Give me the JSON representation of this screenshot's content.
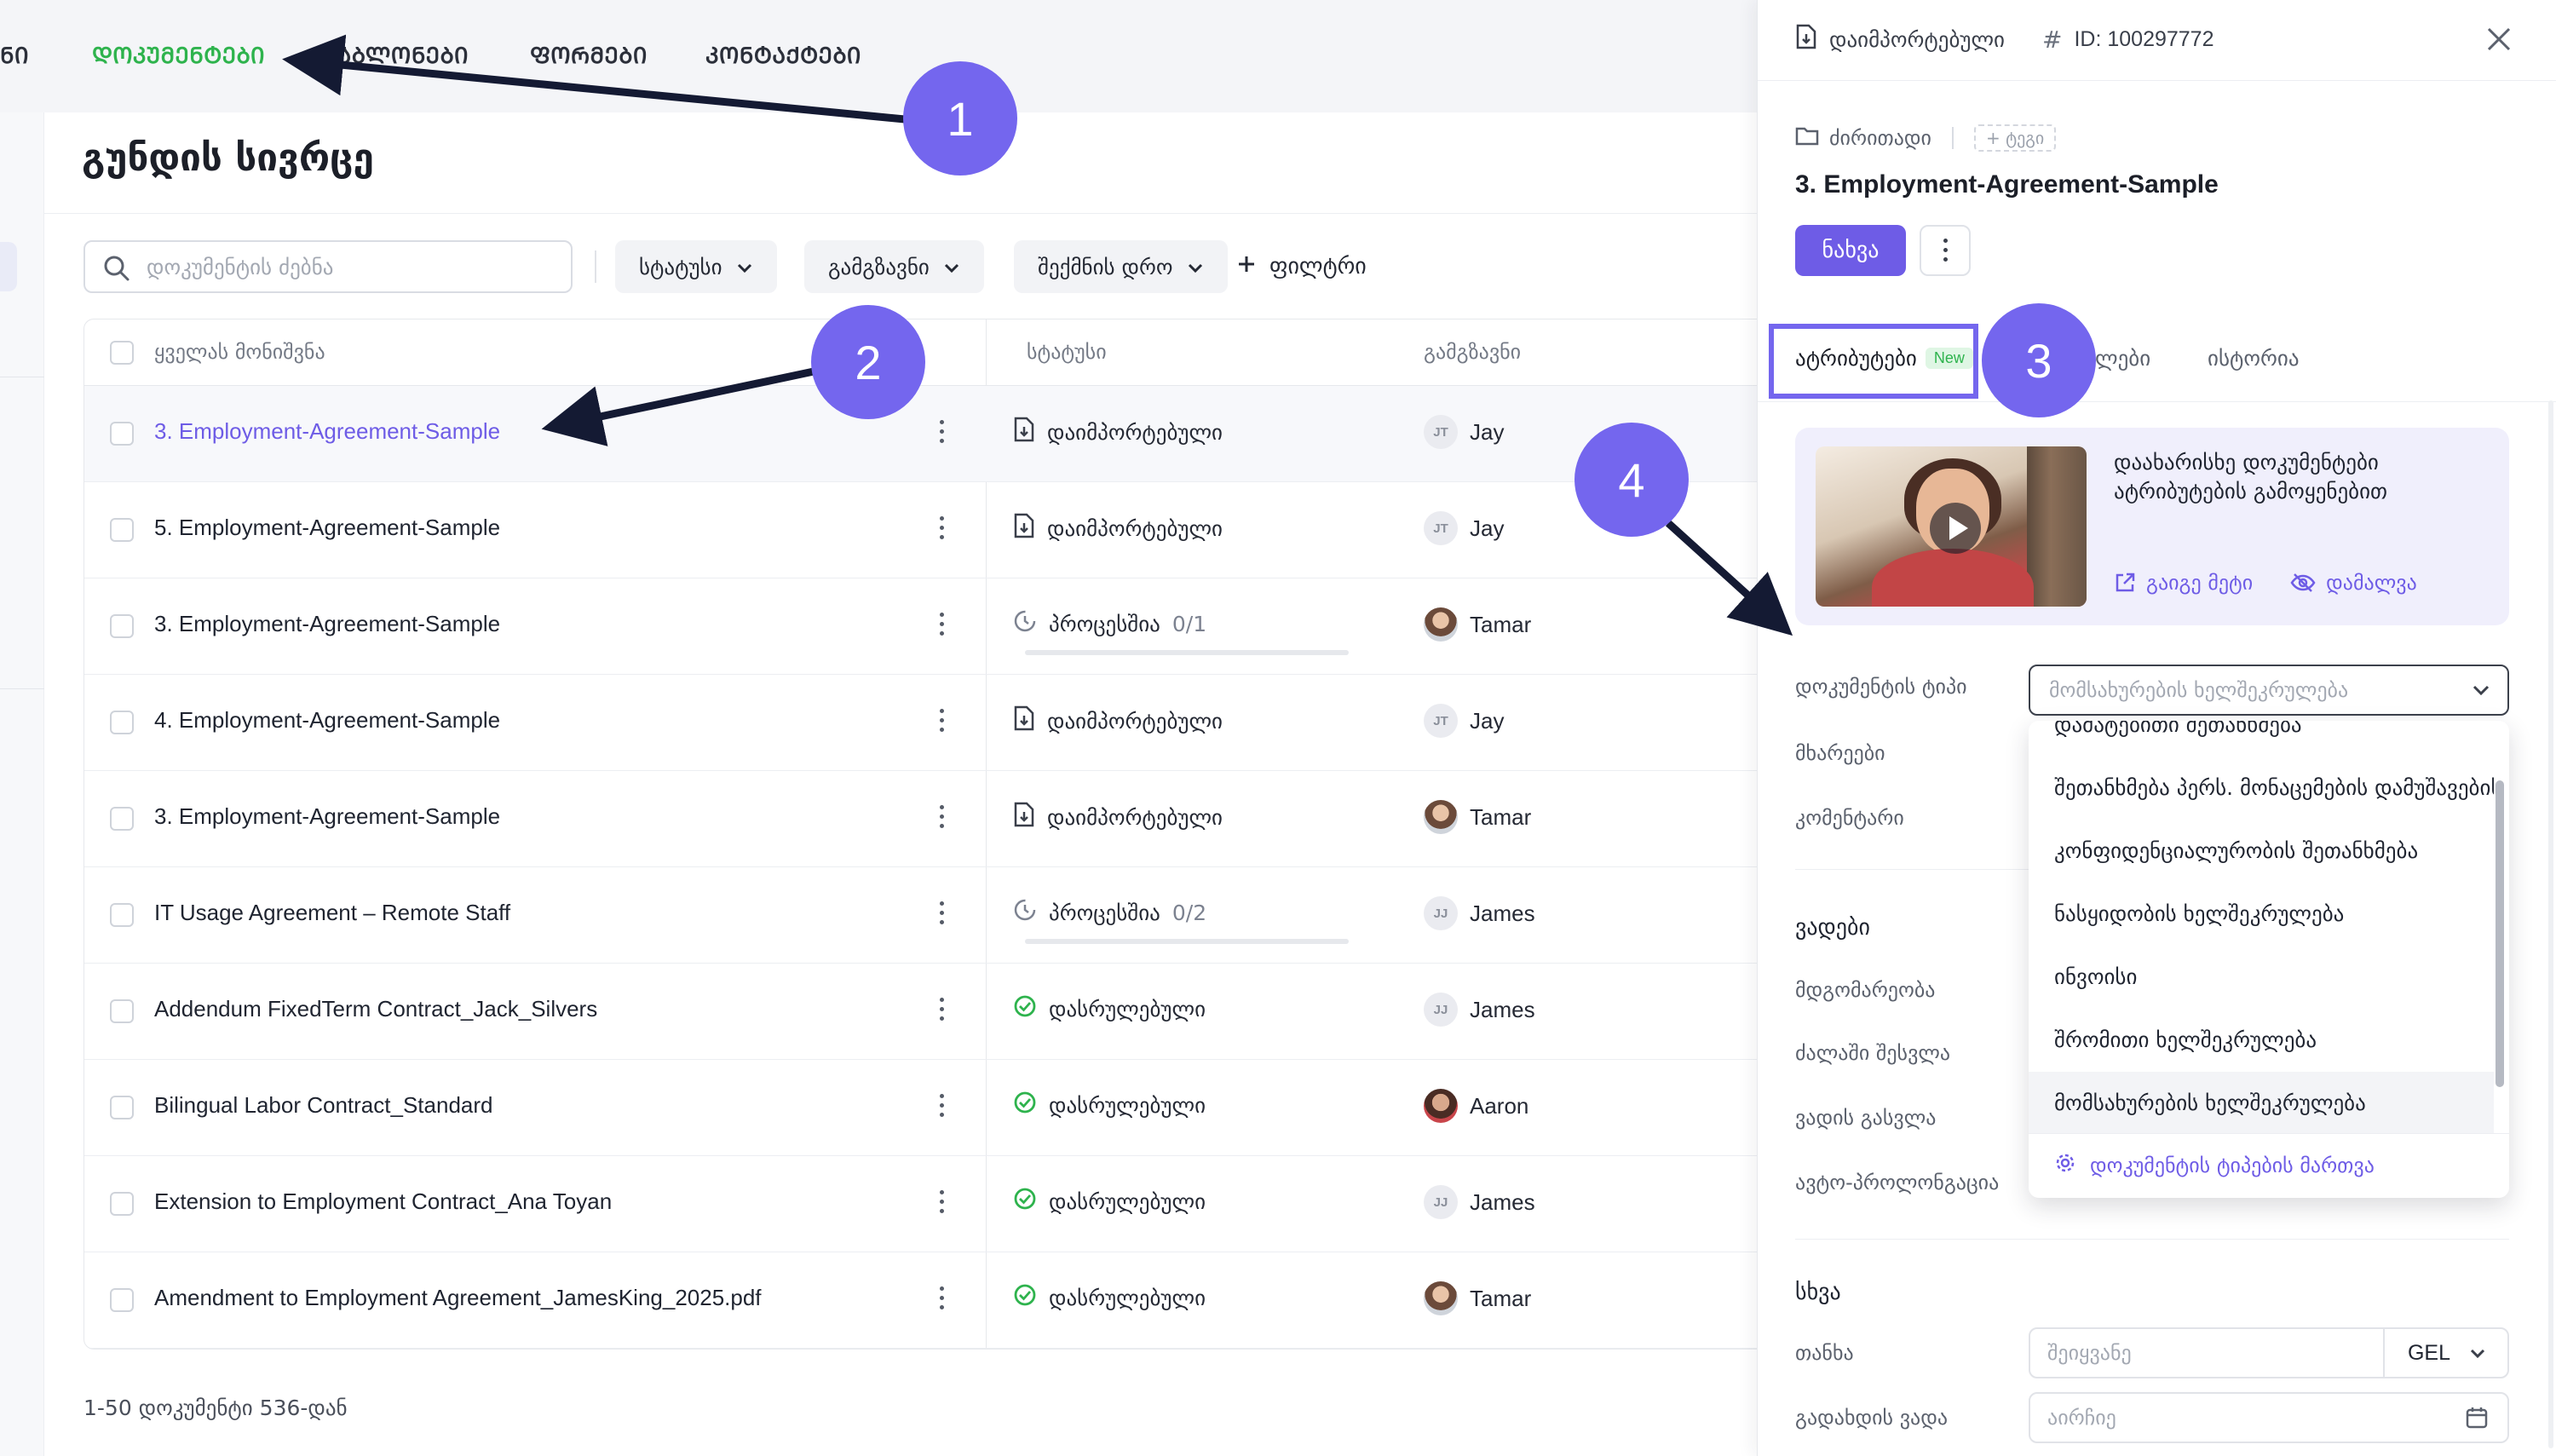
{
  "topnav": {
    "tabs": [
      {
        "label": "ᲜᲘ"
      },
      {
        "label": "ᲓᲝᲙᲣᲛᲔᲜᲢᲔᲑᲘ",
        "active": true
      },
      {
        "label": "ᲨᲐᲑᲚᲝᲜᲔᲑᲘ"
      },
      {
        "label": "ᲤᲝᲠᲛᲔᲑᲘ"
      },
      {
        "label": "ᲙᲝᲜᲢᲐᲥᲢᲔᲑᲘ"
      }
    ]
  },
  "page": {
    "title": "გუნდის სივრცე",
    "search_placeholder": "დოკუმენტის ძებნა",
    "filters": {
      "status": "სტატუსი",
      "sender": "გამგზავნი",
      "created": "შექმნის დრო",
      "add_filter": "ფილტრი"
    },
    "table": {
      "headers": {
        "select_all": "ყველას მონიშვნა",
        "status": "სტატუსი",
        "sender": "გამგზავნი"
      },
      "rows": [
        {
          "name": "3. Employment-Agreement-Sample",
          "status": "დაიმპორტებული",
          "status_type": "imported",
          "sender": "Jay",
          "initials": "JT",
          "avatar": "initials",
          "highlight": true
        },
        {
          "name": "5. Employment-Agreement-Sample",
          "status": "დაიმპორტებული",
          "status_type": "imported",
          "sender": "Jay",
          "initials": "JT",
          "avatar": "initials"
        },
        {
          "name": "3. Employment-Agreement-Sample",
          "status": "პროცესშია",
          "status_count": "0/1",
          "status_type": "progress",
          "progress": 0,
          "sender": "Tamar",
          "initials": "",
          "avatar": "photo"
        },
        {
          "name": "4. Employment-Agreement-Sample",
          "status": "დაიმპორტებული",
          "status_type": "imported",
          "sender": "Jay",
          "initials": "JT",
          "avatar": "initials"
        },
        {
          "name": "3. Employment-Agreement-Sample",
          "status": "დაიმპორტებული",
          "status_type": "imported",
          "sender": "Tamar",
          "initials": "",
          "avatar": "photo"
        },
        {
          "name": "IT Usage Agreement – Remote Staff",
          "status": "პროცესშია",
          "status_count": "0/2",
          "status_type": "progress",
          "progress": 0,
          "sender": "James",
          "initials": "JJ",
          "avatar": "initials"
        },
        {
          "name": "Addendum FixedTerm Contract_Jack_Silvers",
          "status": "დასრულებული",
          "status_type": "done",
          "sender": "James",
          "initials": "JJ",
          "avatar": "initials"
        },
        {
          "name": "Bilingual Labor Contract_Standard",
          "status": "დასრულებული",
          "status_type": "done",
          "sender": "Aaron",
          "initials": "",
          "avatar": "photo2"
        },
        {
          "name": "Extension to Employment Contract_Ana Toyan",
          "status": "დასრულებული",
          "status_type": "done",
          "sender": "James",
          "initials": "JJ",
          "avatar": "initials"
        },
        {
          "name": "Amendment to Employment Agreement_JamesKing_2025.pdf",
          "status": "დასრულებული",
          "status_type": "done",
          "sender": "Tamar",
          "initials": "",
          "avatar": "photo"
        }
      ]
    },
    "footer_count": "1-50 დოკუმენტი 536-დან"
  },
  "panel": {
    "header_status": "დაიმპორტებული",
    "header_id": "ID: 100297772",
    "folder": "ძირითადი",
    "tag_add": "+ ტეგი",
    "doc_title": "3. Employment-Agreement-Sample",
    "view_button": "ნახვა",
    "tabs": {
      "attributes": "ატრიბუტები",
      "new_badge": "New",
      "second_suffix": "ლები",
      "history": "ისტორია"
    },
    "promo": {
      "text": "დაახარისხე დოკუმენტები ატრიბუტების გამოყენებით",
      "learn_more": "გაიგე მეტი",
      "hide": "დამალვა"
    },
    "fields": {
      "doc_type": "დოკუმენტის ტიპი",
      "doc_type_placeholder": "მომსახურების ხელშეკრულება",
      "parties": "მხარეები",
      "comment": "კომენტარი",
      "deadlines": "ვადები",
      "state": "მდგომარეობა",
      "effective": "ძალაში შესვლა",
      "expiry": "ვადის გასვლა",
      "auto_renew": "ავტო-პროლონგაცია",
      "other": "სხვა",
      "amount": "თანხა",
      "amount_placeholder": "შეიყვანე",
      "currency": "GEL",
      "payment_date": "გადახდის ვადა",
      "payment_placeholder": "აირჩიე"
    },
    "dropdown": {
      "options": [
        "დამატებითი შეთანხმება",
        "შეთანხმება პერს. მონაცემების დამუშავების შესახებ",
        "კონფიდენციალურობის შეთანხმება",
        "ნასყიდობის ხელშეკრულება",
        "ინვოისი",
        "შრომითი ხელშეკრულება",
        "მომსახურების ხელშეკრულება"
      ],
      "selected_index": 6,
      "manage": "დოკუმენტის ტიპების მართვა"
    }
  },
  "annotations": [
    "1",
    "2",
    "3",
    "4"
  ],
  "colors": {
    "accent": "#6e5ce6",
    "annotation": "#7466ee",
    "active_tab": "#2eb34d",
    "done": "#2eb34d"
  }
}
